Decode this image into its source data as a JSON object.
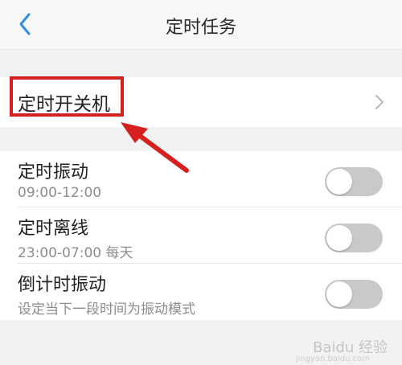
{
  "header": {
    "title": "定时任务",
    "back_icon": "chevron-left-icon"
  },
  "power_schedule": {
    "label": "定时开关机",
    "chevron_icon": "chevron-right-icon"
  },
  "items": [
    {
      "title": "定时振动",
      "subtitle": "09:00-12:00",
      "enabled": false
    },
    {
      "title": "定时离线",
      "subtitle": "23:00-07:00 每天",
      "enabled": false
    },
    {
      "title": "倒计时振动",
      "subtitle": "设定当下一段时间为振动模式",
      "enabled": false
    }
  ],
  "watermark": {
    "text": "Baidu 经验",
    "sub": "jingyan.baidu.com"
  },
  "colors": {
    "accent_blue": "#2f8de4",
    "annotation_red": "#d61f1f",
    "toggle_off": "#c9c9c9"
  }
}
